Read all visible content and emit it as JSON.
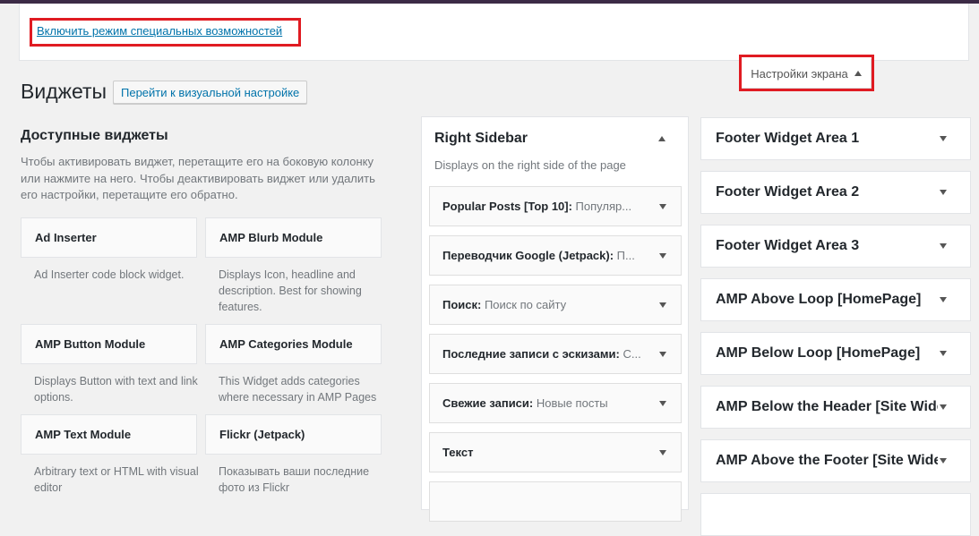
{
  "notice": {
    "accessibility_link": "Включить режим специальных возможностей"
  },
  "screen_options": {
    "label": "Настройки экрана"
  },
  "header": {
    "title": "Виджеты",
    "customizer_button": "Перейти к визуальной настройке"
  },
  "available": {
    "title": "Доступные виджеты",
    "description": "Чтобы активировать виджет, перетащите его на боковую колонку или нажмите на него. Чтобы деактивировать виджет или удалить его настройки, перетащите его обратно.",
    "widgets": [
      {
        "name": "Ad Inserter",
        "desc": "Ad Inserter code block widget."
      },
      {
        "name": "AMP Blurb Module",
        "desc": "Displays Icon, headline and description. Best for showing features."
      },
      {
        "name": "AMP Button Module",
        "desc": "Displays Button with text and link options."
      },
      {
        "name": "AMP Categories Module",
        "desc": "This Widget adds categories where necessary in AMP Pages"
      },
      {
        "name": "AMP Text Module",
        "desc": "Arbitrary text or HTML with visual editor"
      },
      {
        "name": "Flickr (Jetpack)",
        "desc": "Показывать ваши последние фото из Flickr"
      }
    ]
  },
  "right_sidebar": {
    "title": "Right Sidebar",
    "subtitle": "Displays on the right side of the page",
    "widgets": [
      {
        "title": "Popular Posts [Top 10]:",
        "subtitle": " Популяр..."
      },
      {
        "title": "Переводчик Google (Jetpack):",
        "subtitle": " П..."
      },
      {
        "title": "Поиск:",
        "subtitle": " Поиск по сайту"
      },
      {
        "title": "Последние записи с эскизами:",
        "subtitle": " С..."
      },
      {
        "title": "Свежие записи:",
        "subtitle": " Новые посты"
      },
      {
        "title": "Текст",
        "subtitle": ""
      }
    ]
  },
  "widget_areas": [
    "Footer Widget Area 1",
    "Footer Widget Area 2",
    "Footer Widget Area 3",
    "AMP Above Loop [HomePage]",
    "AMP Below Loop [HomePage]",
    "AMP Below the Header [Site Wide]",
    "AMP Above the Footer [Site Wide]"
  ],
  "colors": {
    "link": "#0073aa",
    "highlight": "#e01b22",
    "admin_bar": "#3c2b46"
  }
}
